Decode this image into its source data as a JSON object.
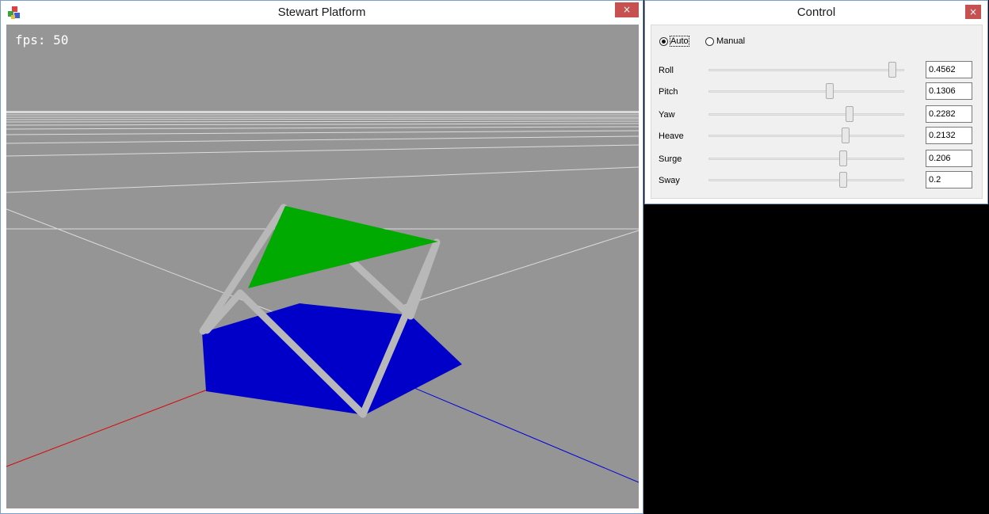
{
  "stewart_window": {
    "title": "Stewart Platform",
    "close_label": "×",
    "fps_text": "fps: 50",
    "colors": {
      "viewport_bg": "#959595",
      "top_platform": "#00aa00",
      "base_platform": "#0000c8",
      "legs": "#b8b8b8",
      "x_axis": "#dd0000",
      "z_axis": "#0000dd",
      "grid": "#e0e0e0"
    }
  },
  "control_window": {
    "title": "Control",
    "close_label": "×",
    "modes": [
      {
        "label": "Auto",
        "selected": true
      },
      {
        "label": "Manual",
        "selected": false
      }
    ],
    "sliders": [
      {
        "label": "Roll",
        "value": "0.4562",
        "position": 0.94
      },
      {
        "label": "Pitch",
        "value": "0.1306",
        "position": 0.62
      },
      {
        "label": "Yaw",
        "value": "0.2282",
        "position": 0.72
      },
      {
        "label": "Heave",
        "value": "0.2132",
        "position": 0.7
      },
      {
        "label": "Surge",
        "value": "0.206",
        "position": 0.69
      },
      {
        "label": "Sway",
        "value": "0.2",
        "position": 0.69
      }
    ]
  }
}
